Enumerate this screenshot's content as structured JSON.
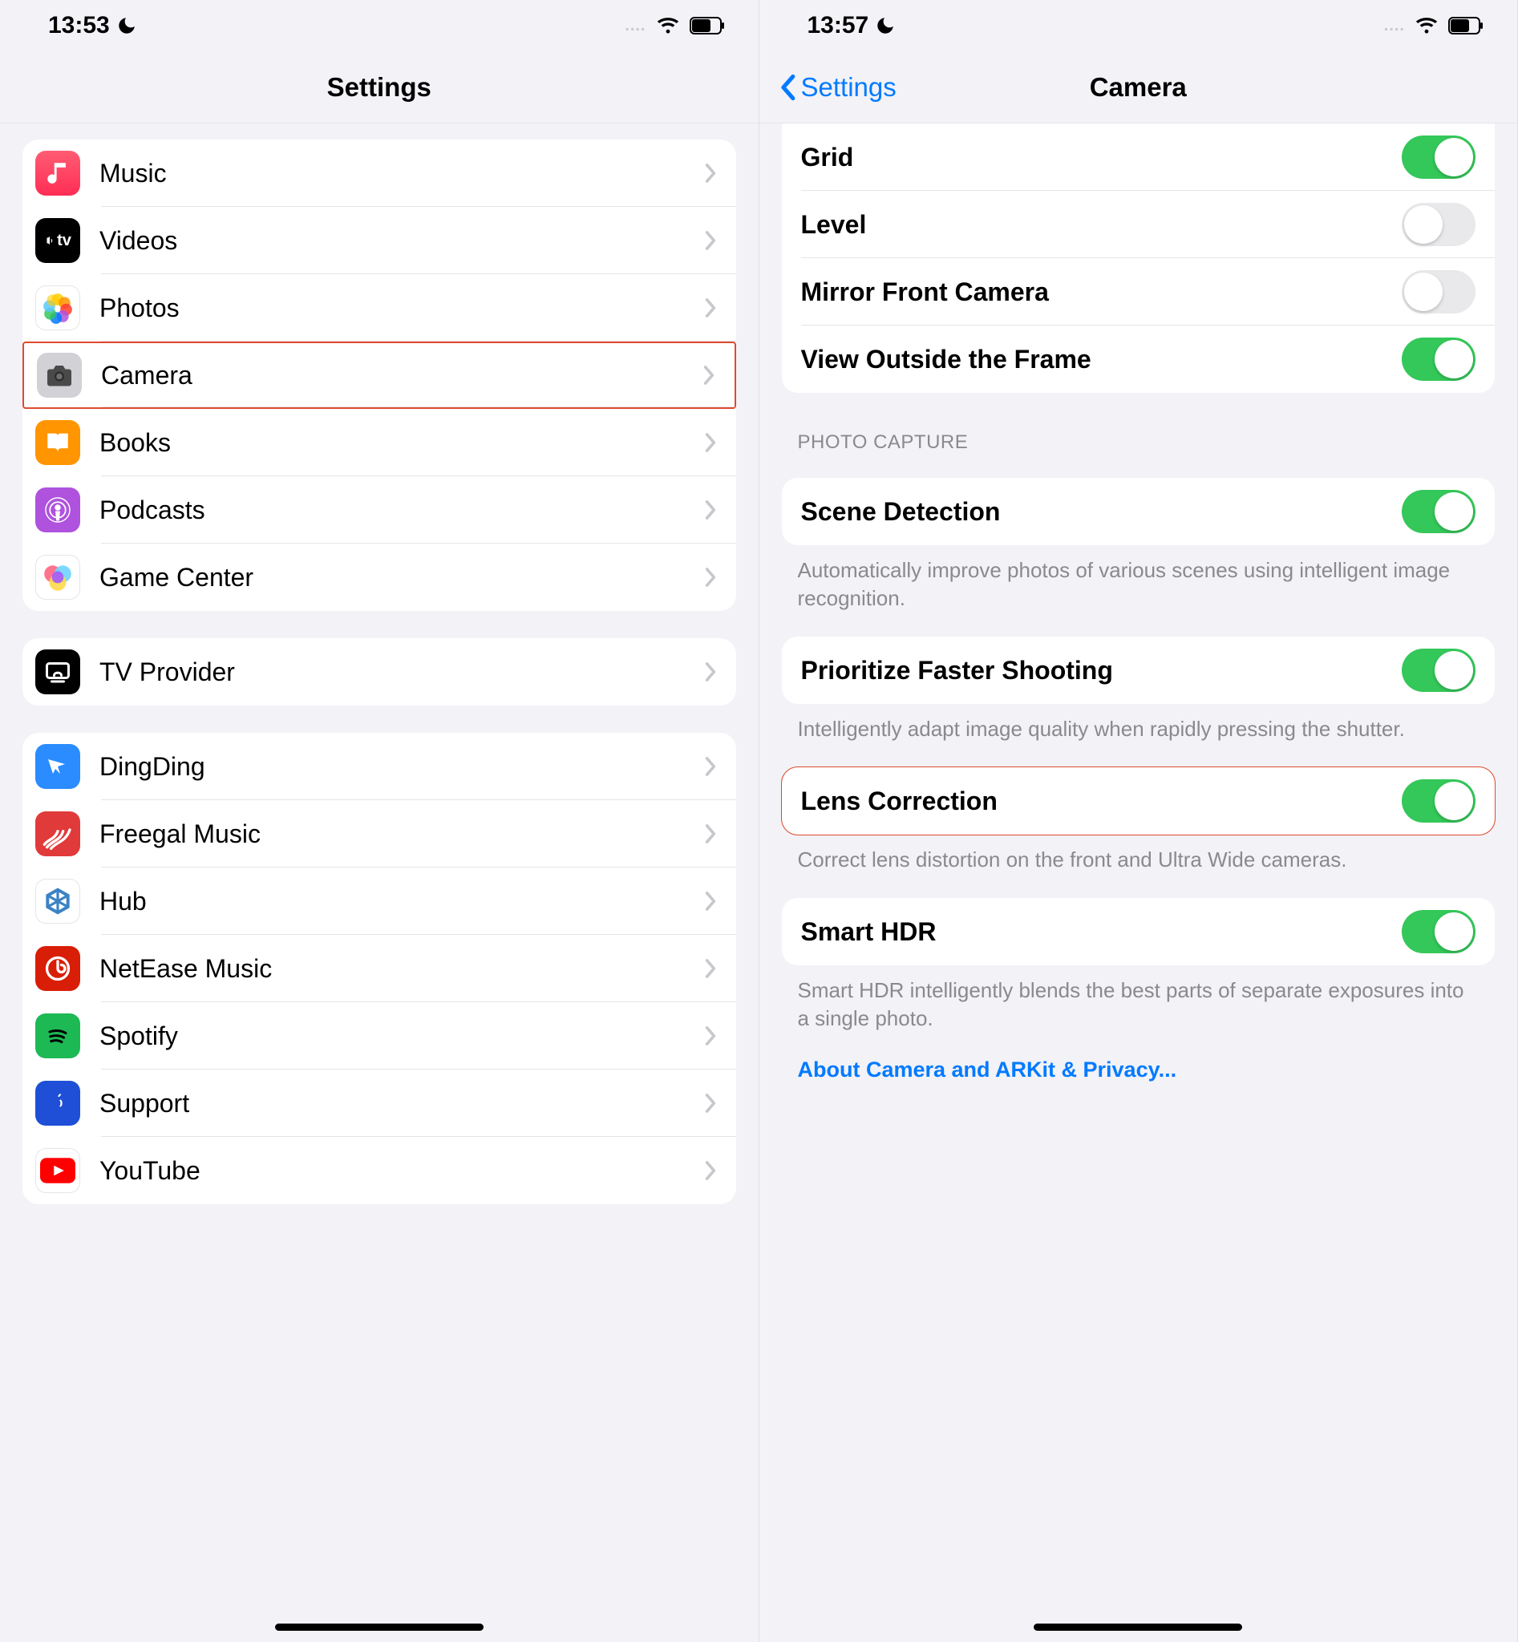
{
  "left": {
    "status": {
      "time": "13:53",
      "dnd_icon": "moon",
      "dots": "....",
      "wifi": true,
      "battery": true
    },
    "nav": {
      "title": "Settings"
    },
    "groups": [
      {
        "items": [
          {
            "name": "music",
            "label": "Music",
            "icon_bg": "linear-gradient(180deg,#ff5c74,#ff2d55)",
            "svg": "music"
          },
          {
            "name": "videos",
            "label": "Videos",
            "icon_bg": "#000",
            "svg": "tv"
          },
          {
            "name": "photos",
            "label": "Photos",
            "icon_bg": "#fff",
            "svg": "photos"
          },
          {
            "name": "camera",
            "label": "Camera",
            "icon_bg": "#d1d1d6",
            "svg": "camera",
            "highlight": true
          },
          {
            "name": "books",
            "label": "Books",
            "icon_bg": "#ff9500",
            "svg": "book"
          },
          {
            "name": "podcasts",
            "label": "Podcasts",
            "icon_bg": "#af52de",
            "svg": "podcast"
          },
          {
            "name": "gamecenter",
            "label": "Game Center",
            "icon_bg": "#fff",
            "svg": "gamecenter"
          }
        ]
      },
      {
        "items": [
          {
            "name": "tvprovider",
            "label": "TV Provider",
            "icon_bg": "#000",
            "svg": "tvprovider"
          }
        ]
      },
      {
        "items": [
          {
            "name": "dingding",
            "label": "DingDing",
            "icon_bg": "#2a8cff",
            "svg": "dingding"
          },
          {
            "name": "freegal",
            "label": "Freegal Music",
            "icon_bg": "#e13a3a",
            "svg": "freegal"
          },
          {
            "name": "hub",
            "label": "Hub",
            "icon_bg": "#fff",
            "svg": "hub"
          },
          {
            "name": "netease",
            "label": "NetEase Music",
            "icon_bg": "#d81e06",
            "svg": "netease"
          },
          {
            "name": "spotify",
            "label": "Spotify",
            "icon_bg": "#1db954",
            "svg": "spotify"
          },
          {
            "name": "support",
            "label": "Support",
            "icon_bg": "#1e4fd6",
            "svg": "support"
          },
          {
            "name": "youtube",
            "label": "YouTube",
            "icon_bg": "#fff",
            "svg": "youtube"
          }
        ]
      }
    ]
  },
  "right": {
    "status": {
      "time": "13:57",
      "dnd_icon": "moon",
      "dots": "....",
      "wifi": true,
      "battery": true
    },
    "nav": {
      "back": "Settings",
      "title": "Camera"
    },
    "sections": [
      {
        "rows": [
          {
            "name": "grid",
            "label": "Grid",
            "on": true
          },
          {
            "name": "level",
            "label": "Level",
            "on": false
          },
          {
            "name": "mirror",
            "label": "Mirror Front Camera",
            "on": false
          },
          {
            "name": "view-outside",
            "label": "View Outside the Frame",
            "on": true
          }
        ]
      },
      {
        "header": "PHOTO CAPTURE",
        "rows": [
          {
            "name": "scene-detection",
            "label": "Scene Detection",
            "on": true
          }
        ],
        "footer": "Automatically improve photos of various scenes using intelligent image recognition."
      },
      {
        "rows": [
          {
            "name": "prioritize-faster",
            "label": "Prioritize Faster Shooting",
            "on": true
          }
        ],
        "footer": "Intelligently adapt image quality when rapidly pressing the shutter."
      },
      {
        "rows": [
          {
            "name": "lens-correction",
            "label": "Lens Correction",
            "on": true,
            "highlight": true
          }
        ],
        "footer": "Correct lens distortion on the front and Ultra Wide cameras."
      },
      {
        "rows": [
          {
            "name": "smart-hdr",
            "label": "Smart HDR",
            "on": true
          }
        ],
        "footer": "Smart HDR intelligently blends the best parts of separate exposures into a single photo."
      }
    ],
    "link": "About Camera and ARKit & Privacy..."
  }
}
